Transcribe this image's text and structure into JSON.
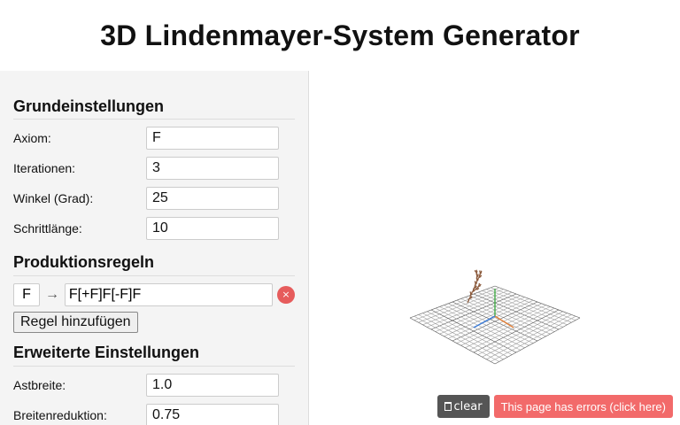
{
  "header": {
    "title": "3D Lindenmayer-System Generator"
  },
  "basic": {
    "title": "Grundeinstellungen",
    "fields": [
      {
        "label": "Axiom:",
        "value": "F"
      },
      {
        "label": "Iterationen:",
        "value": "3"
      },
      {
        "label": "Winkel (Grad):",
        "value": "25"
      },
      {
        "label": "Schrittlänge:",
        "value": "10"
      }
    ]
  },
  "rules": {
    "title": "Produktionsregeln",
    "items": [
      {
        "predecessor": "F",
        "arrow": "→",
        "successor": "F[+F]F[-F]F",
        "remove": "×"
      }
    ],
    "add_label": "Regel hinzufügen"
  },
  "advanced": {
    "title": "Erweiterte Einstellungen",
    "fields": [
      {
        "label": "Astbreite:",
        "value": "1.0"
      },
      {
        "label": "Breitenreduktion:",
        "value": "0.75"
      }
    ]
  },
  "toolbar": {
    "clear_icon": "trash-icon",
    "clear_label": "clear",
    "error_label": "This page has errors (click here)"
  },
  "colors": {
    "branch": "#8b5a3c",
    "grid": "#9e9e9e",
    "error": "#f26a6a",
    "clear": "#555555"
  }
}
